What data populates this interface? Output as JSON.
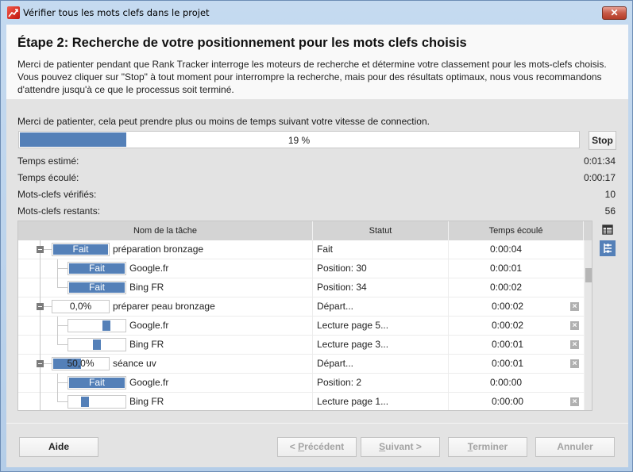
{
  "window": {
    "title": "Vérifier tous les mots clefs dans le projet",
    "close_label": "✕"
  },
  "header": {
    "step_title": "Étape 2: Recherche de votre positionnement pour les mots clefs choisis",
    "description": "Merci de patienter pendant que Rank Tracker interroge les moteurs de recherche et détermine votre classement pour les mots-clefs choisis. Vous pouvez cliquer sur \"Stop\" à tout moment pour interrompre la recherche, mais pour des résultats optimaux, nous vous recommandons d'attendre jusqu'à ce que le processus soit terminé."
  },
  "progress": {
    "message": "Merci de patienter, cela peut prendre plus ou moins de temps suivant votre vitesse de connection.",
    "percent": 19,
    "label": "19 %",
    "stop_label": "Stop"
  },
  "stats": [
    {
      "label": "Temps estimé:",
      "value": "0:01:34"
    },
    {
      "label": "Temps écoulé:",
      "value": "0:00:17"
    },
    {
      "label": "Mots-clefs vérifiés:",
      "value": "10"
    },
    {
      "label": "Mots-clefs restants:",
      "value": "56"
    }
  ],
  "table": {
    "columns": [
      "Nom de la tâche",
      "Statut",
      "Temps écoulé"
    ],
    "rows": [
      {
        "level": 0,
        "name": "préparation bronzage",
        "bar_text": "Fait",
        "progress": 1.0,
        "status": "Fait",
        "time": "0:00:04",
        "cancel": false
      },
      {
        "level": 1,
        "name": "Google.fr",
        "bar_text": "Fait",
        "progress": 1.0,
        "status": "Position: 30",
        "time": "0:00:01",
        "cancel": false
      },
      {
        "level": 1,
        "name": "Bing FR",
        "bar_text": "Fait",
        "progress": 1.0,
        "status": "Position: 34",
        "time": "0:00:02",
        "cancel": false,
        "last": true
      },
      {
        "level": 0,
        "name": "préparer peau bronzage",
        "bar_text": "0,0%",
        "progress": 0.0,
        "status": "Départ...",
        "time": "0:00:02",
        "cancel": true
      },
      {
        "level": 1,
        "name": "Google.fr",
        "bar_text": "",
        "progress": 0.0,
        "indeterminate_pos": 0.7,
        "status": "Lecture page 5...",
        "time": "0:00:02",
        "cancel": true
      },
      {
        "level": 1,
        "name": "Bing FR",
        "bar_text": "",
        "progress": 0.0,
        "indeterminate_pos": 0.5,
        "status": "Lecture page 3...",
        "time": "0:00:01",
        "cancel": true,
        "last": true
      },
      {
        "level": 0,
        "name": "séance uv",
        "bar_text": "50,0%",
        "progress": 0.5,
        "status": "Départ...",
        "time": "0:00:01",
        "cancel": true
      },
      {
        "level": 1,
        "name": "Google.fr",
        "bar_text": "Fait",
        "progress": 1.0,
        "status": "Position: 2",
        "time": "0:00:00",
        "cancel": false
      },
      {
        "level": 1,
        "name": "Bing FR",
        "bar_text": "",
        "progress": 0.0,
        "indeterminate_pos": 0.25,
        "status": "Lecture page 1...",
        "time": "0:00:00",
        "cancel": true,
        "last": true
      }
    ]
  },
  "side_icons": [
    "table-view-icon",
    "tree-view-icon"
  ],
  "buttons": {
    "help": "Aide",
    "previous": {
      "prefix": "< ",
      "mnemonic": "P",
      "rest": "récédent"
    },
    "next": {
      "mnemonic": "S",
      "rest": "uivant >"
    },
    "finish": {
      "mnemonic": "T",
      "rest": "erminer"
    },
    "cancel": "Annuler"
  },
  "colors": {
    "accent": "#5480b8",
    "close_red": "#c75a47"
  }
}
